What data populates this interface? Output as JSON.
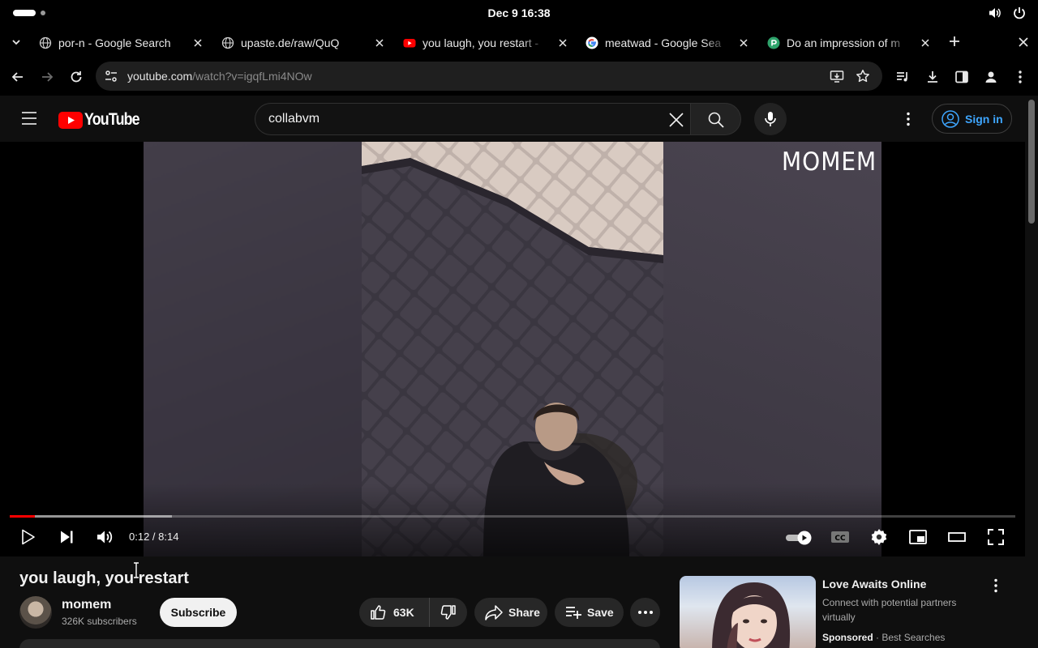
{
  "system": {
    "clock": "Dec 9  16:38"
  },
  "tabs": [
    {
      "title": "por-n - Google Search",
      "favicon": "globe-icon",
      "fade": false
    },
    {
      "title": "upaste.de/raw/QuQ",
      "favicon": "globe-icon",
      "fade": false
    },
    {
      "title": "you laugh, you restart -",
      "favicon": "youtube-icon",
      "fade": true
    },
    {
      "title": "meatwad - Google Sea",
      "favicon": "google-icon",
      "fade": true
    },
    {
      "title": "Do an impression of m",
      "favicon": "poe-icon",
      "fade": true
    }
  ],
  "omnibox": {
    "domain": "youtube.com",
    "path": "/watch?v=igqfLmi4NOw"
  },
  "youtube": {
    "logo_text": "YouTube",
    "search_value": "collabvm",
    "sign_in": "Sign in"
  },
  "player": {
    "watermark": "MOMEM",
    "time": "0:12 / 8:14",
    "played_fraction": 0.025,
    "buffered_fraction": 0.161
  },
  "video": {
    "title": "you laugh, you restart",
    "channel": "momem",
    "subscribers": "326K subscribers",
    "subscribe_label": "Subscribe",
    "likes": "63K",
    "share_label": "Share",
    "save_label": "Save"
  },
  "ad": {
    "title": "Love Awaits Online",
    "description": "Connect with potential partners virtually",
    "sponsored": "Sponsored",
    "separator": " · ",
    "advertiser": "Best Searches"
  },
  "colors": {
    "yt_red": "#ff0000",
    "link_blue": "#3ea6ff",
    "background": "#0f0f0f"
  }
}
